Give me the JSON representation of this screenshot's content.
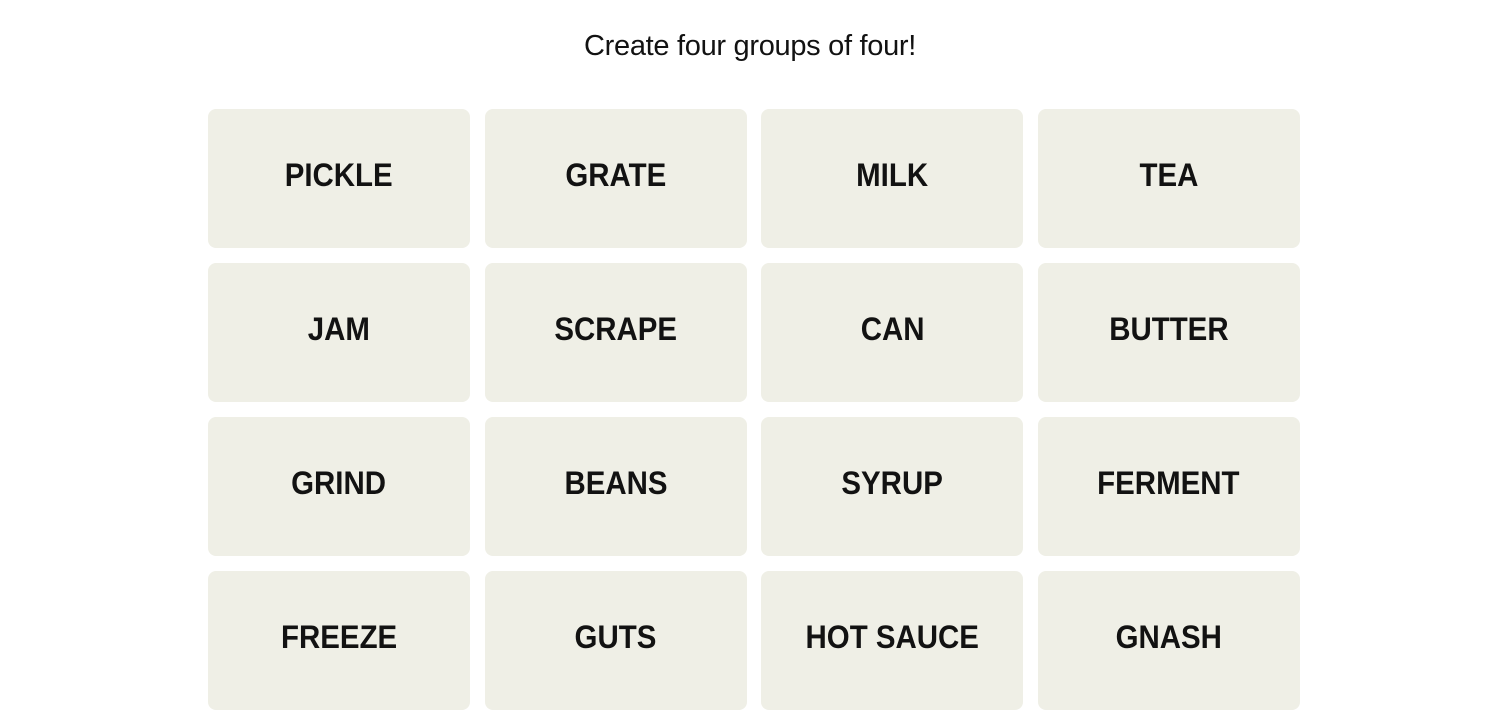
{
  "instructions": "Create four groups of four!",
  "tiles": [
    {
      "label": "PICKLE"
    },
    {
      "label": "GRATE"
    },
    {
      "label": "MILK"
    },
    {
      "label": "TEA"
    },
    {
      "label": "JAM"
    },
    {
      "label": "SCRAPE"
    },
    {
      "label": "CAN"
    },
    {
      "label": "BUTTER"
    },
    {
      "label": "GRIND"
    },
    {
      "label": "BEANS"
    },
    {
      "label": "SYRUP"
    },
    {
      "label": "FERMENT"
    },
    {
      "label": "FREEZE"
    },
    {
      "label": "GUTS"
    },
    {
      "label": "HOT SAUCE"
    },
    {
      "label": "GNASH"
    }
  ],
  "colors": {
    "tile_background": "#efefe6",
    "text": "#121212",
    "page_background": "#ffffff"
  }
}
